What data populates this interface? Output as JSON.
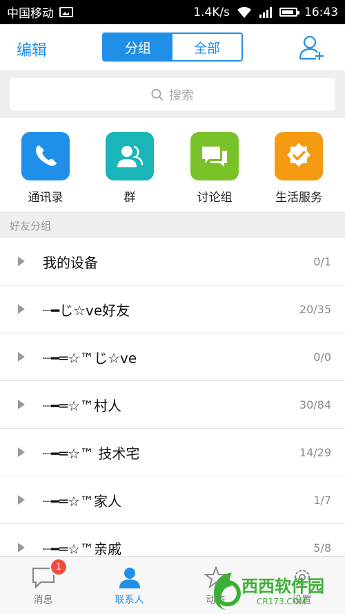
{
  "status_bar": {
    "carrier": "中国移动",
    "speed": "1.4K/s",
    "time": "16:43"
  },
  "header": {
    "edit": "编辑",
    "segments": [
      "分组",
      "全部"
    ],
    "add_friend_icon": "add-friend-icon"
  },
  "search": {
    "placeholder": "搜索"
  },
  "quick": [
    {
      "label": "通讯录",
      "icon": "phone-icon",
      "color": "#1f8fe8"
    },
    {
      "label": "群",
      "icon": "group-icon",
      "color": "#1ab5b8"
    },
    {
      "label": "讨论组",
      "icon": "discussion-icon",
      "color": "#7ac229"
    },
    {
      "label": "生活服务",
      "icon": "service-icon",
      "color": "#f59b12"
    }
  ],
  "section": {
    "title": "好友分组"
  },
  "groups": [
    {
      "name": "我的设备",
      "count": "0/1"
    },
    {
      "name": "┈━じ☆ve好友",
      "count": "20/35"
    },
    {
      "name": "┈━═☆™じ☆ve",
      "count": "0/0"
    },
    {
      "name": "┈━═☆™村人",
      "count": "30/84"
    },
    {
      "name": "┈━═☆™ 技术宅",
      "count": "14/29"
    },
    {
      "name": "┈━═☆™家人",
      "count": "1/7"
    },
    {
      "name": "┈━═☆™亲戚",
      "count": "5/8"
    }
  ],
  "tabs": [
    {
      "label": "消息",
      "badge": "1"
    },
    {
      "label": "联系人"
    },
    {
      "label": "动态"
    },
    {
      "label": "设置"
    }
  ],
  "watermark": {
    "brand": "西西软件园",
    "domain": "CR173.COM"
  },
  "colors": {
    "accent": "#1f8fe8",
    "badge": "#f24a3c"
  }
}
